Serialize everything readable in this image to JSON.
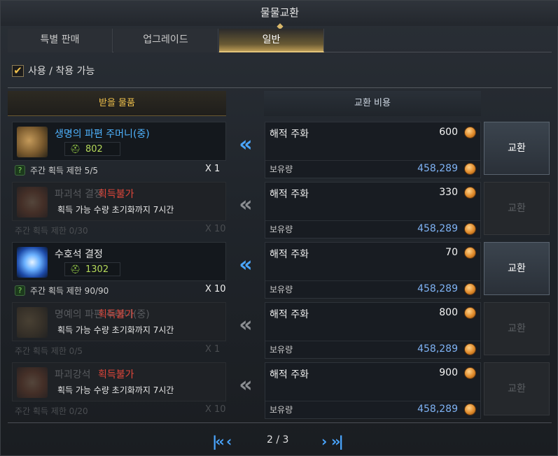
{
  "window": {
    "title": "물물교환"
  },
  "tabs": [
    {
      "label": "특별 판매",
      "active": false
    },
    {
      "label": "업그레이드",
      "active": false
    },
    {
      "label": "일반",
      "active": true
    }
  ],
  "filter": {
    "label": "사용 / 착용 가능",
    "checked": true
  },
  "columns": {
    "receive": "받을 물품",
    "cost": "교환 비용"
  },
  "rows": [
    {
      "item_name": "생명의 파편 주머니(중)",
      "power": "802",
      "limit": "주간 획득 제한 5/5",
      "qty": "X 1",
      "available": true,
      "cost_name": "해적 주화",
      "cost_amount": "600",
      "hold_label": "보유량",
      "hold_amount": "458,289",
      "button": "교환"
    },
    {
      "item_name": "파괴석 결정",
      "unavailable": "획득불가",
      "reset_msg": "획득 가능 수량 초기화까지 7시간",
      "limit": "주간 획득 제한 0/30",
      "qty": "X 10",
      "available": false,
      "cost_name": "해적 주화",
      "cost_amount": "330",
      "hold_label": "보유량",
      "hold_amount": "458,289",
      "button": "교환"
    },
    {
      "item_name": "수호석 결정",
      "power": "1302",
      "limit": "주간 획득 제한 90/90",
      "qty": "X 10",
      "available": true,
      "cost_name": "해적 주화",
      "cost_amount": "70",
      "hold_label": "보유량",
      "hold_amount": "458,289",
      "button": "교환"
    },
    {
      "item_name": "명예의 파편 주머니(중)",
      "unavailable": "획득불가",
      "reset_msg": "획득 가능 수량 초기화까지 7시간",
      "limit": "주간 획득 제한 0/5",
      "qty": "X 1",
      "available": false,
      "cost_name": "해적 주화",
      "cost_amount": "800",
      "hold_label": "보유량",
      "hold_amount": "458,289",
      "button": "교환"
    },
    {
      "item_name": "파괴강석",
      "unavailable": "획득불가",
      "reset_msg": "획득 가능 수량 초기화까지 7시간",
      "limit": "주간 획득 제한 0/20",
      "qty": "X 10",
      "available": false,
      "cost_name": "해적 주화",
      "cost_amount": "900",
      "hold_label": "보유량",
      "hold_amount": "458,289",
      "button": "교환"
    }
  ],
  "pagination": {
    "current": "2 / 3"
  },
  "icons": {
    "arrow": "double-chevron-left-icon",
    "coin": "pirate-coin-icon",
    "power": "helmet-icon",
    "help": "question-icon",
    "first": "first-page-icon",
    "prev": "prev-page-icon",
    "next": "next-page-icon",
    "last": "last-page-icon"
  },
  "colors": {
    "accent": "#4aa6ff",
    "gold": "#f0c14b",
    "unavailable": "#e0463a"
  }
}
